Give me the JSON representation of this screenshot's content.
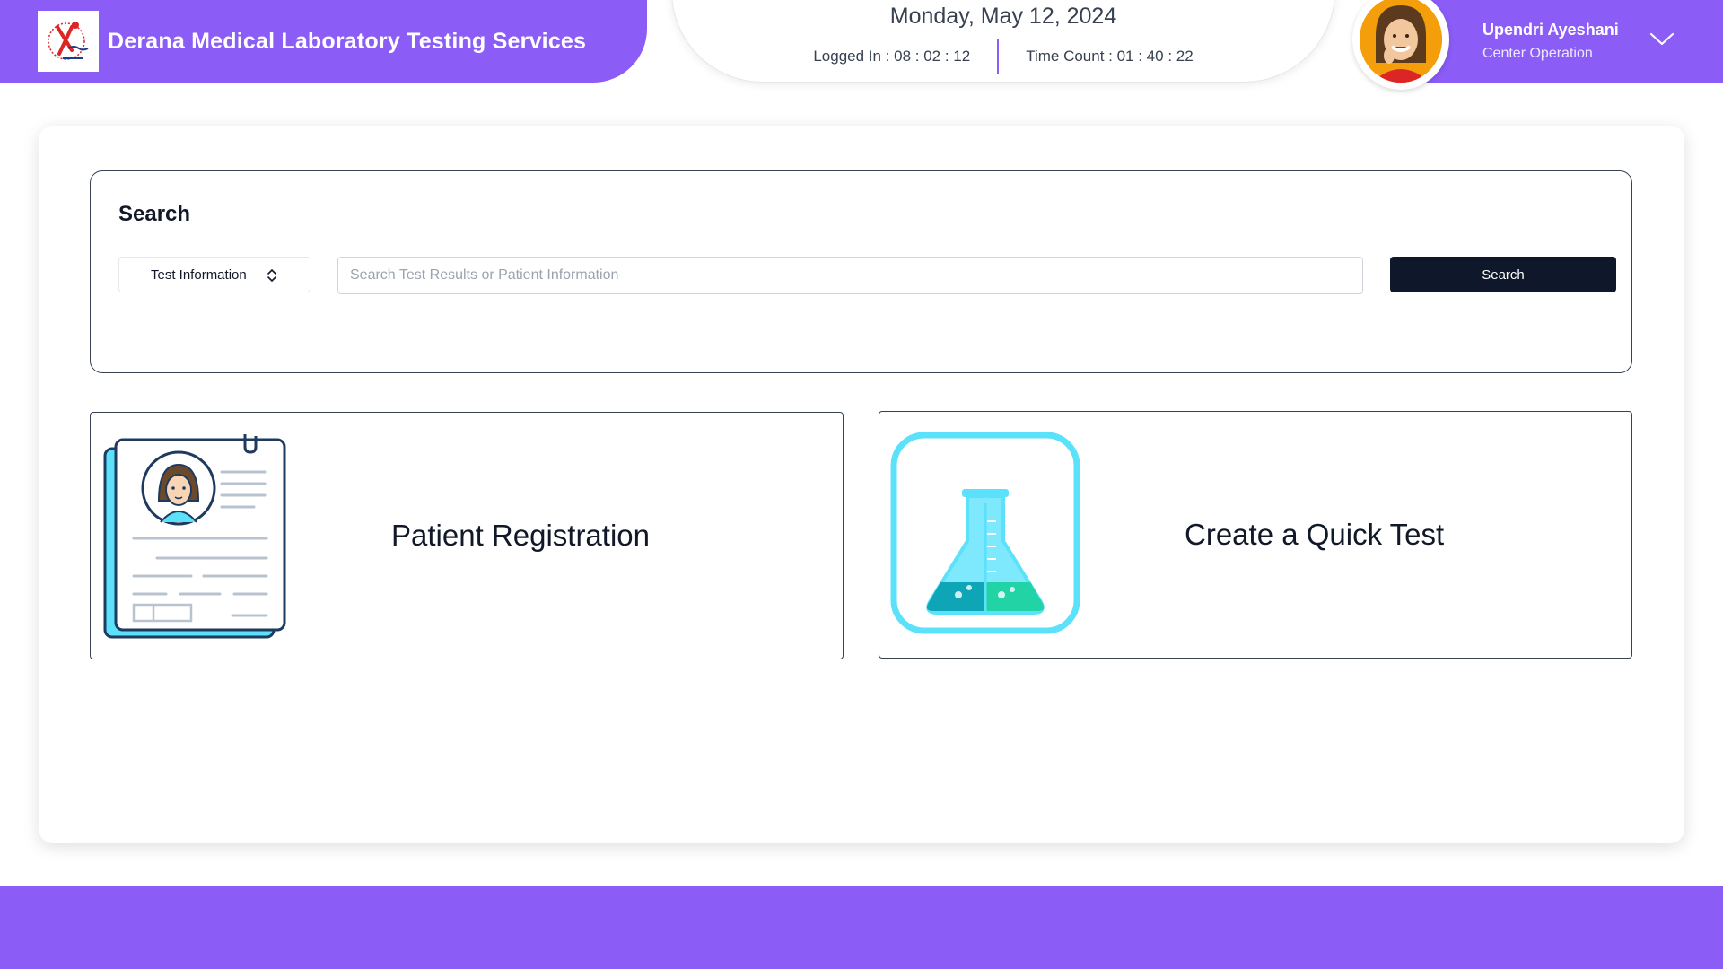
{
  "header": {
    "brand_title": "Derana Medical Laboratory Testing Services",
    "date": "Monday, May 12, 2024",
    "logged_in": "Logged In : 08 : 02 : 12",
    "time_count": "Time Count : 01 : 40 : 22",
    "user_name": "Upendri Ayeshani",
    "user_role": "Center Operation"
  },
  "search": {
    "heading": "Search",
    "filter_selected": "Test Information",
    "placeholder": "Search Test Results or Patient Information",
    "button_label": "Search"
  },
  "tiles": [
    {
      "label": "Patient Registration",
      "icon": "patient-record-icon"
    },
    {
      "label": "Create a Quick Test",
      "icon": "flask-icon"
    }
  ],
  "colors": {
    "brand": "#8b5cf6",
    "dark_button": "#0f172a",
    "accent_cyan": "#5ce1fb"
  }
}
